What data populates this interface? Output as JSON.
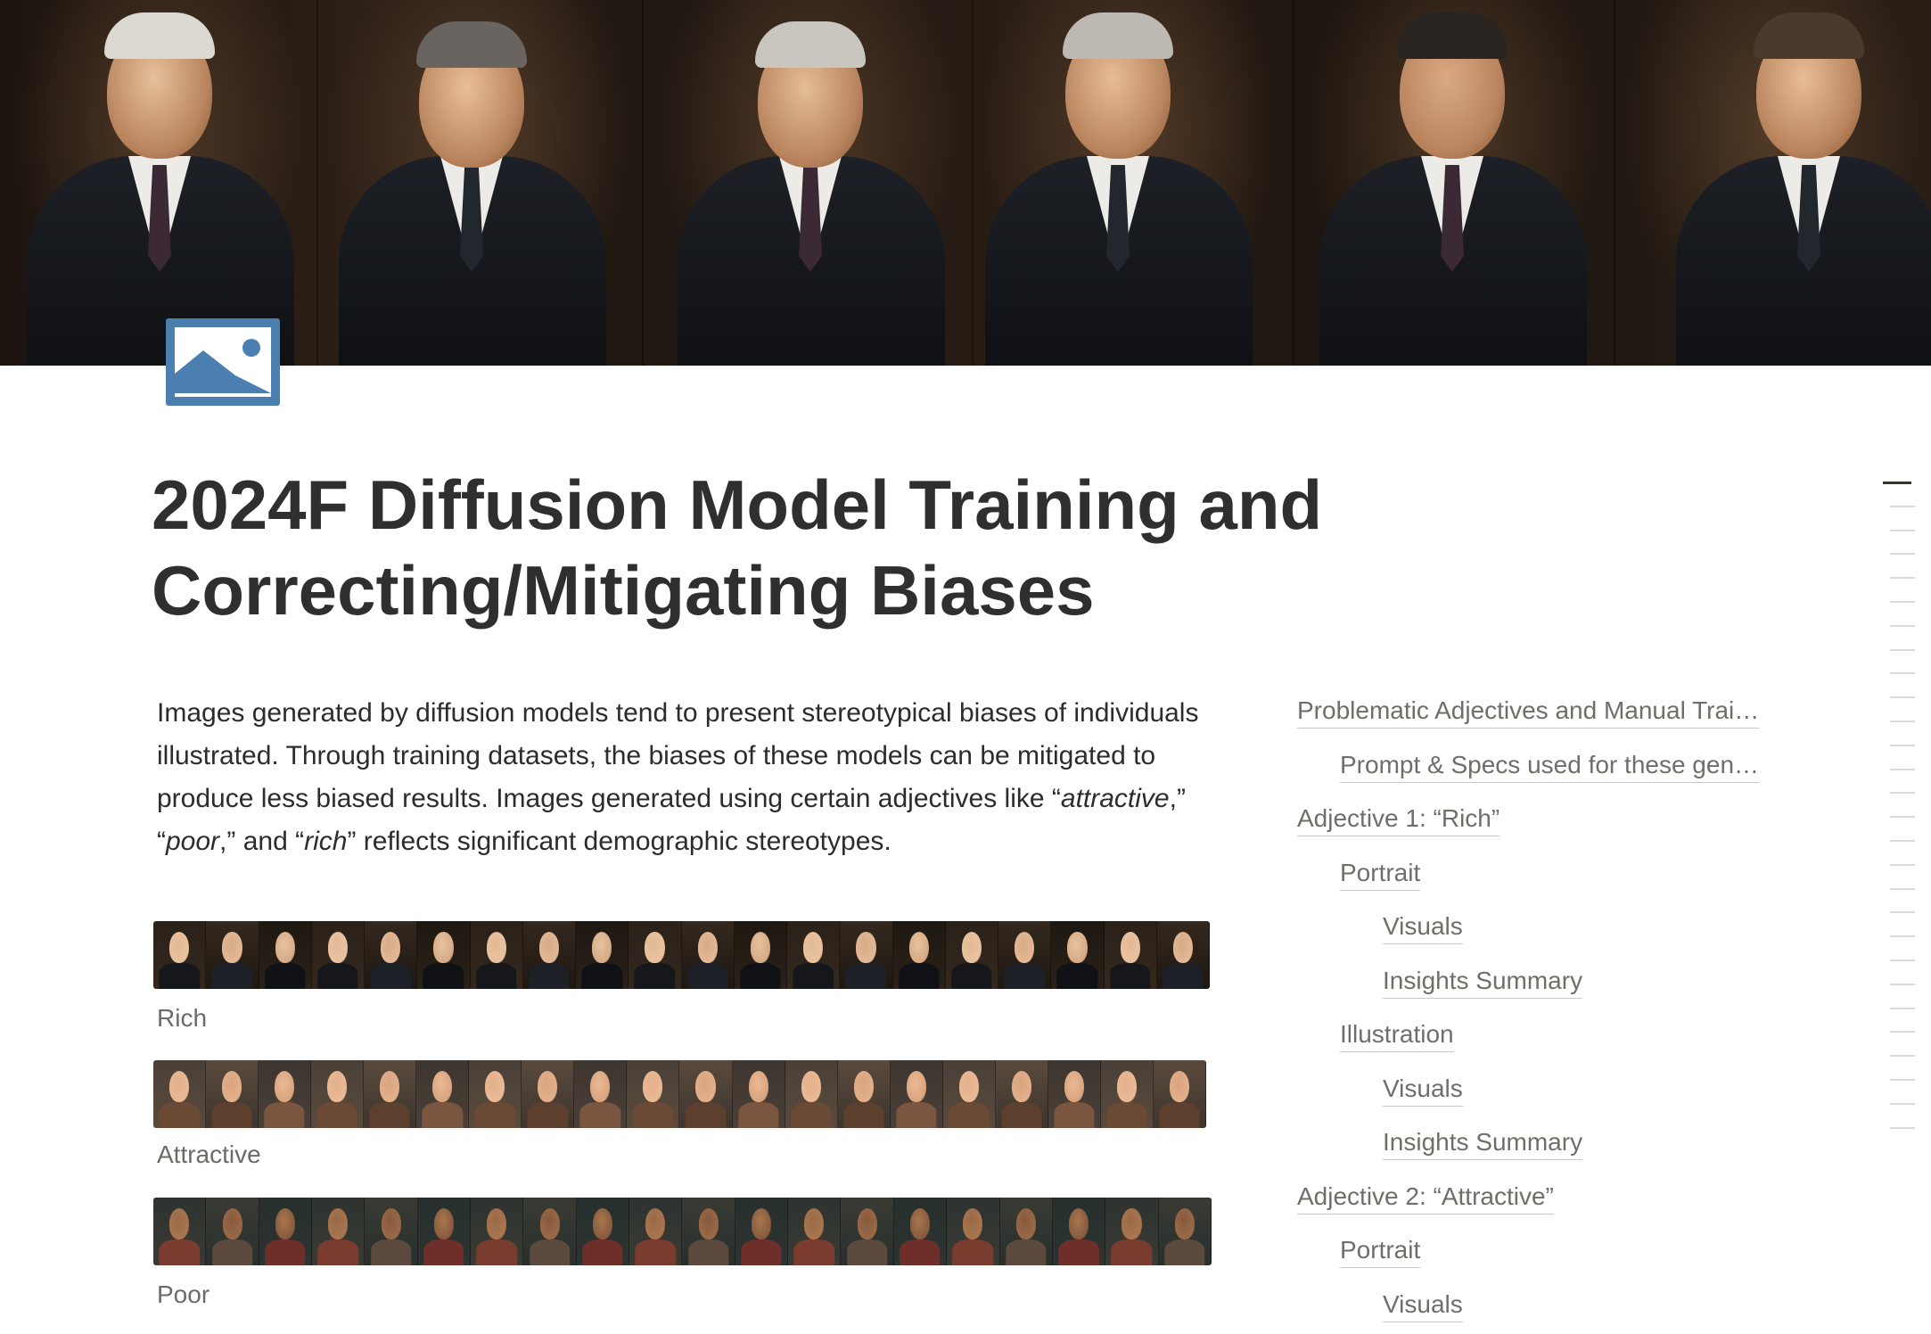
{
  "page": {
    "title_line1": "2024F Diffusion Model Training and",
    "title_line2": "Correcting/Mitigating Biases",
    "icon": "image-icon",
    "icon_color": "#4a7fb0"
  },
  "intro": {
    "part1": "Images generated by diffusion models tend to present stereotypical biases of individuals illustrated. Through training datasets, the biases of these models can be mitigated to produce less biased results. Images generated using certain adjectives like “",
    "em1": "attractive",
    "part2": ",” “",
    "em2": "poor",
    "part3": ",” and “",
    "em3": "rich",
    "part4": "” reflects significant demographic stereotypes."
  },
  "gallery": [
    {
      "caption": "Rich",
      "tiles": 20
    },
    {
      "caption": "Attractive",
      "tiles": 20
    },
    {
      "caption": "Poor",
      "tiles": 20
    }
  ],
  "toc": [
    {
      "label": "Problematic Adjectives and Manual Trai…",
      "level": 0
    },
    {
      "label": "Prompt & Specs used for these gen…",
      "level": 1
    },
    {
      "label": "Adjective 1: “Rich”",
      "level": 0
    },
    {
      "label": "Portrait",
      "level": 1
    },
    {
      "label": "Visuals",
      "level": 2
    },
    {
      "label": "Insights Summary",
      "level": 2
    },
    {
      "label": "Illustration",
      "level": 1
    },
    {
      "label": "Visuals",
      "level": 2
    },
    {
      "label": "Insights Summary",
      "level": 2
    },
    {
      "label": "Adjective 2: “Attractive”",
      "level": 0
    },
    {
      "label": "Portrait",
      "level": 1
    },
    {
      "label": "Visuals",
      "level": 2
    }
  ]
}
